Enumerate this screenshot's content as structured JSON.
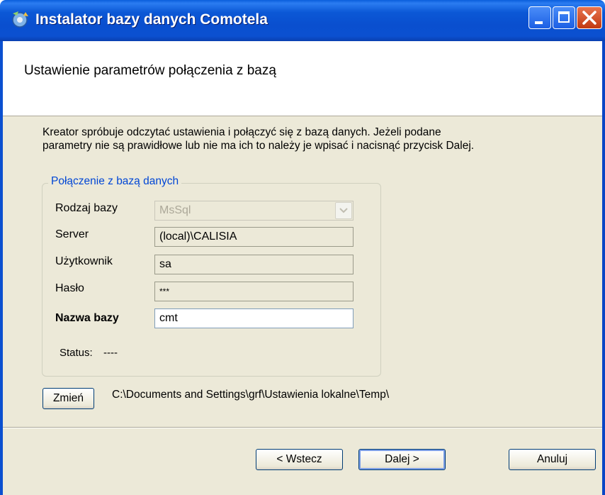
{
  "window": {
    "title": "Instalator bazy danych Comotela",
    "icon": "installer-icon",
    "controls": [
      "minimize",
      "maximize",
      "close"
    ]
  },
  "header": {
    "title": "Ustawienie parametrów połączenia z bazą"
  },
  "description": {
    "line1": "Kreator spróbuje  odczytać ustawienia i połączyć się z bazą danych. Jeżeli podane",
    "line2": "parametry nie są prawidłowe lub nie ma ich to należy je wpisać  i nacisnąć przycisk Dalej."
  },
  "connection": {
    "legend": "Połączenie z bazą danych",
    "db_type_label": "Rodzaj bazy",
    "db_type_value": "MsSql",
    "server_label": "Server",
    "server_value": "(local)\\CALISIA",
    "user_label": "Użytkownik",
    "user_value": "sa",
    "password_label": "Hasło",
    "password_value": "***",
    "dbname_label": "Nazwa bazy",
    "dbname_value": "cmt",
    "status_label": "Status:",
    "status_value": "----"
  },
  "path": {
    "change_label": "Zmień",
    "value": "C:\\Documents and Settings\\grf\\Ustawienia lokalne\\Temp\\"
  },
  "footer": {
    "back_label": "< Wstecz",
    "next_label": "Dalej >",
    "cancel_label": "Anuluj"
  },
  "colors": {
    "titlebar": "#0b58d6",
    "dialog_bg": "#ece9d8",
    "group_legend": "#0046d5",
    "close_button": "#c23a12"
  }
}
